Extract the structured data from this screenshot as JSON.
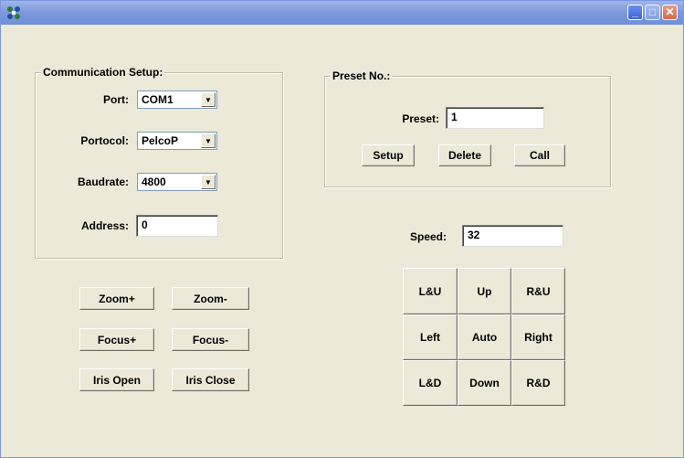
{
  "communication": {
    "title": "Communication Setup:",
    "port_label": "Port:",
    "port_value": "COM1",
    "protocol_label": "Portocol:",
    "protocol_value": "PelcoP",
    "baudrate_label": "Baudrate:",
    "baudrate_value": "4800",
    "address_label": "Address:",
    "address_value": "0"
  },
  "preset": {
    "title": "Preset No.:",
    "preset_label": "Preset:",
    "preset_value": "1",
    "setup": "Setup",
    "delete": "Delete",
    "call": "Call"
  },
  "speed": {
    "label": "Speed:",
    "value": "32"
  },
  "lens": {
    "zoom_in": "Zoom+",
    "zoom_out": "Zoom-",
    "focus_in": "Focus+",
    "focus_out": "Focus-",
    "iris_open": "Iris Open",
    "iris_close": "Iris Close"
  },
  "ptz": {
    "lu": "L&U",
    "up": "Up",
    "ru": "R&U",
    "left": "Left",
    "auto": "Auto",
    "right": "Right",
    "ld": "L&D",
    "down": "Down",
    "rd": "R&D"
  },
  "icons": {
    "app": "app-icon",
    "minimize": "minimize-icon",
    "maximize": "maximize-icon",
    "close": "close-icon"
  }
}
